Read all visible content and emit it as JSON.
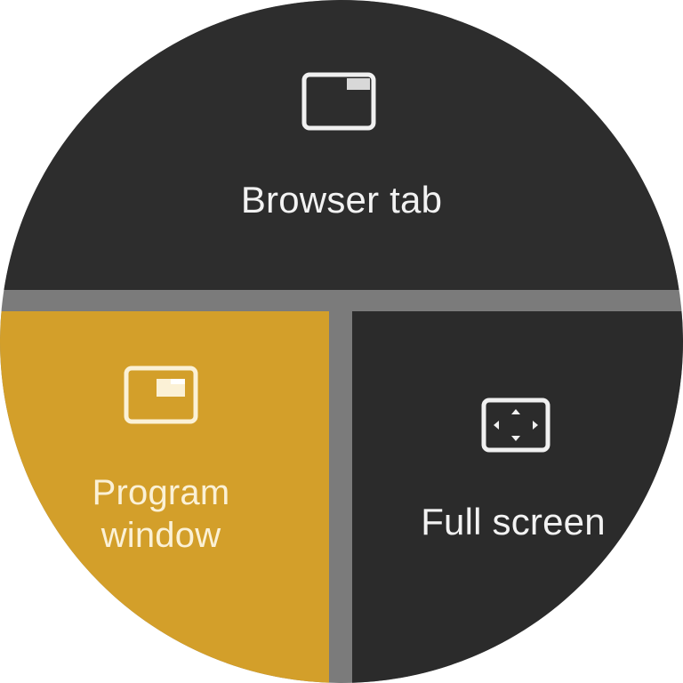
{
  "options": {
    "browser_tab": {
      "label": "Browser tab",
      "icon": "browser-tab-icon",
      "color": "#2d2d2d",
      "selected": false
    },
    "program_window": {
      "label_line1": "Program",
      "label_line2": "window",
      "icon": "program-window-icon",
      "color": "#d39f2a",
      "selected": true
    },
    "full_screen": {
      "label": "Full screen",
      "icon": "full-screen-icon",
      "color": "#2b2b2b",
      "selected": false
    }
  },
  "colors": {
    "separator": "#7b7b7b",
    "text": "#f2f2f2",
    "selected_text": "#fbf1d6"
  }
}
